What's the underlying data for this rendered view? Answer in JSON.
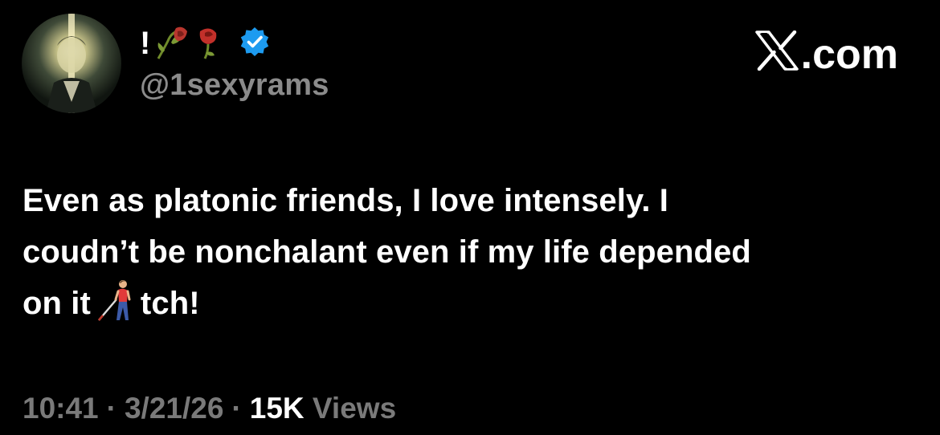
{
  "profile": {
    "display_name": "!",
    "handle": "@1sexyrams",
    "avatar_icon": "anime-character-avatar-icon",
    "name_emoji_icons": [
      "wilted-flower-icon",
      "wilted-rose-icon"
    ],
    "verified": true,
    "verified_color": "#1d9bf0"
  },
  "brand": {
    "label": ".com",
    "logo_icon": "x-logo-icon"
  },
  "tweet": {
    "line1": "Even as platonic friends, I love intensely. I",
    "line2": "coudn’t be nonchalant even if my life depended",
    "line3_before": "on it",
    "line3_emoji_icon": "person-with-white-cane-icon",
    "line3_after": "tch!"
  },
  "meta": {
    "time": "10:41",
    "date": "3/21/26",
    "separator": "·",
    "views_count": "15K",
    "views_label": "Views"
  },
  "colors": {
    "background": "#000000",
    "primary_text": "#ffffff",
    "secondary_text": "#8b8b8b"
  }
}
